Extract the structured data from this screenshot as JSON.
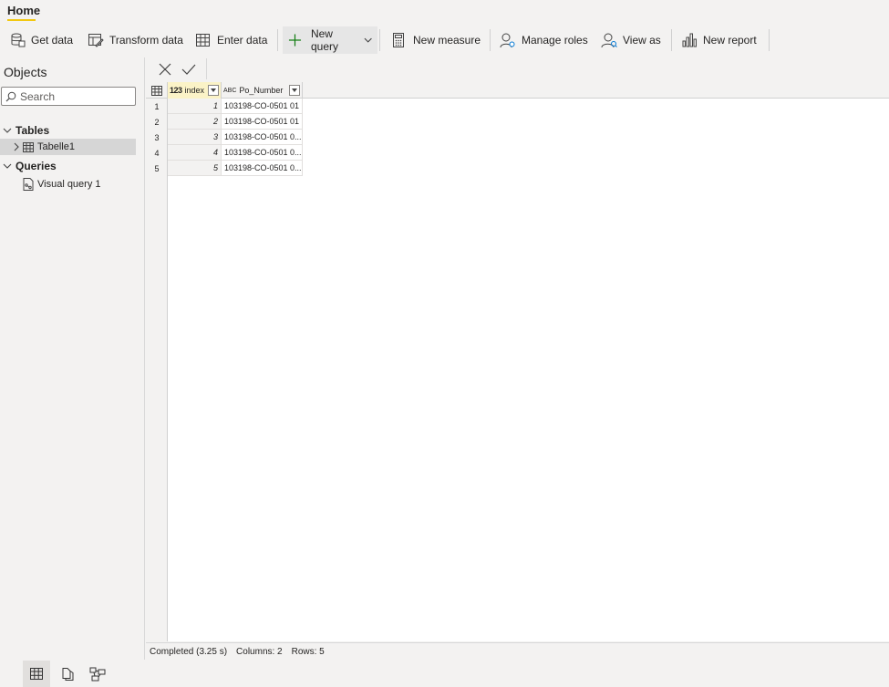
{
  "ribbon": {
    "tab_home": "Home",
    "get_data": "Get data",
    "transform_data": "Transform data",
    "enter_data": "Enter data",
    "new_query": "New query",
    "new_measure": "New measure",
    "manage_roles": "Manage roles",
    "view_as": "View as",
    "new_report": "New report"
  },
  "left_pane": {
    "title": "Objects",
    "search_placeholder": "Search",
    "tables_header": "Tables",
    "table_item": "Tabelle1",
    "queries_header": "Queries",
    "query_item": "Visual query 1"
  },
  "grid": {
    "columns": [
      {
        "type_icon": "123",
        "name": "index"
      },
      {
        "type_icon": "ABC",
        "name": "Po_Number"
      }
    ],
    "rows": [
      {
        "num": "1",
        "index": "1",
        "po": "103198-CO-0501 01"
      },
      {
        "num": "2",
        "index": "2",
        "po": "103198-CO-0501 01"
      },
      {
        "num": "3",
        "index": "3",
        "po": "103198-CO-0501 0..."
      },
      {
        "num": "4",
        "index": "4",
        "po": "103198-CO-0501 0..."
      },
      {
        "num": "5",
        "index": "5",
        "po": "103198-CO-0501 0..."
      }
    ]
  },
  "status": {
    "completed": "Completed (3.25 s)",
    "columns": "Columns: 2",
    "rows": "Rows: 5"
  },
  "colors": {
    "accent": "#f2c811",
    "index_header_bg": "#fbf3c7",
    "new_query_plus": "#107c10"
  }
}
